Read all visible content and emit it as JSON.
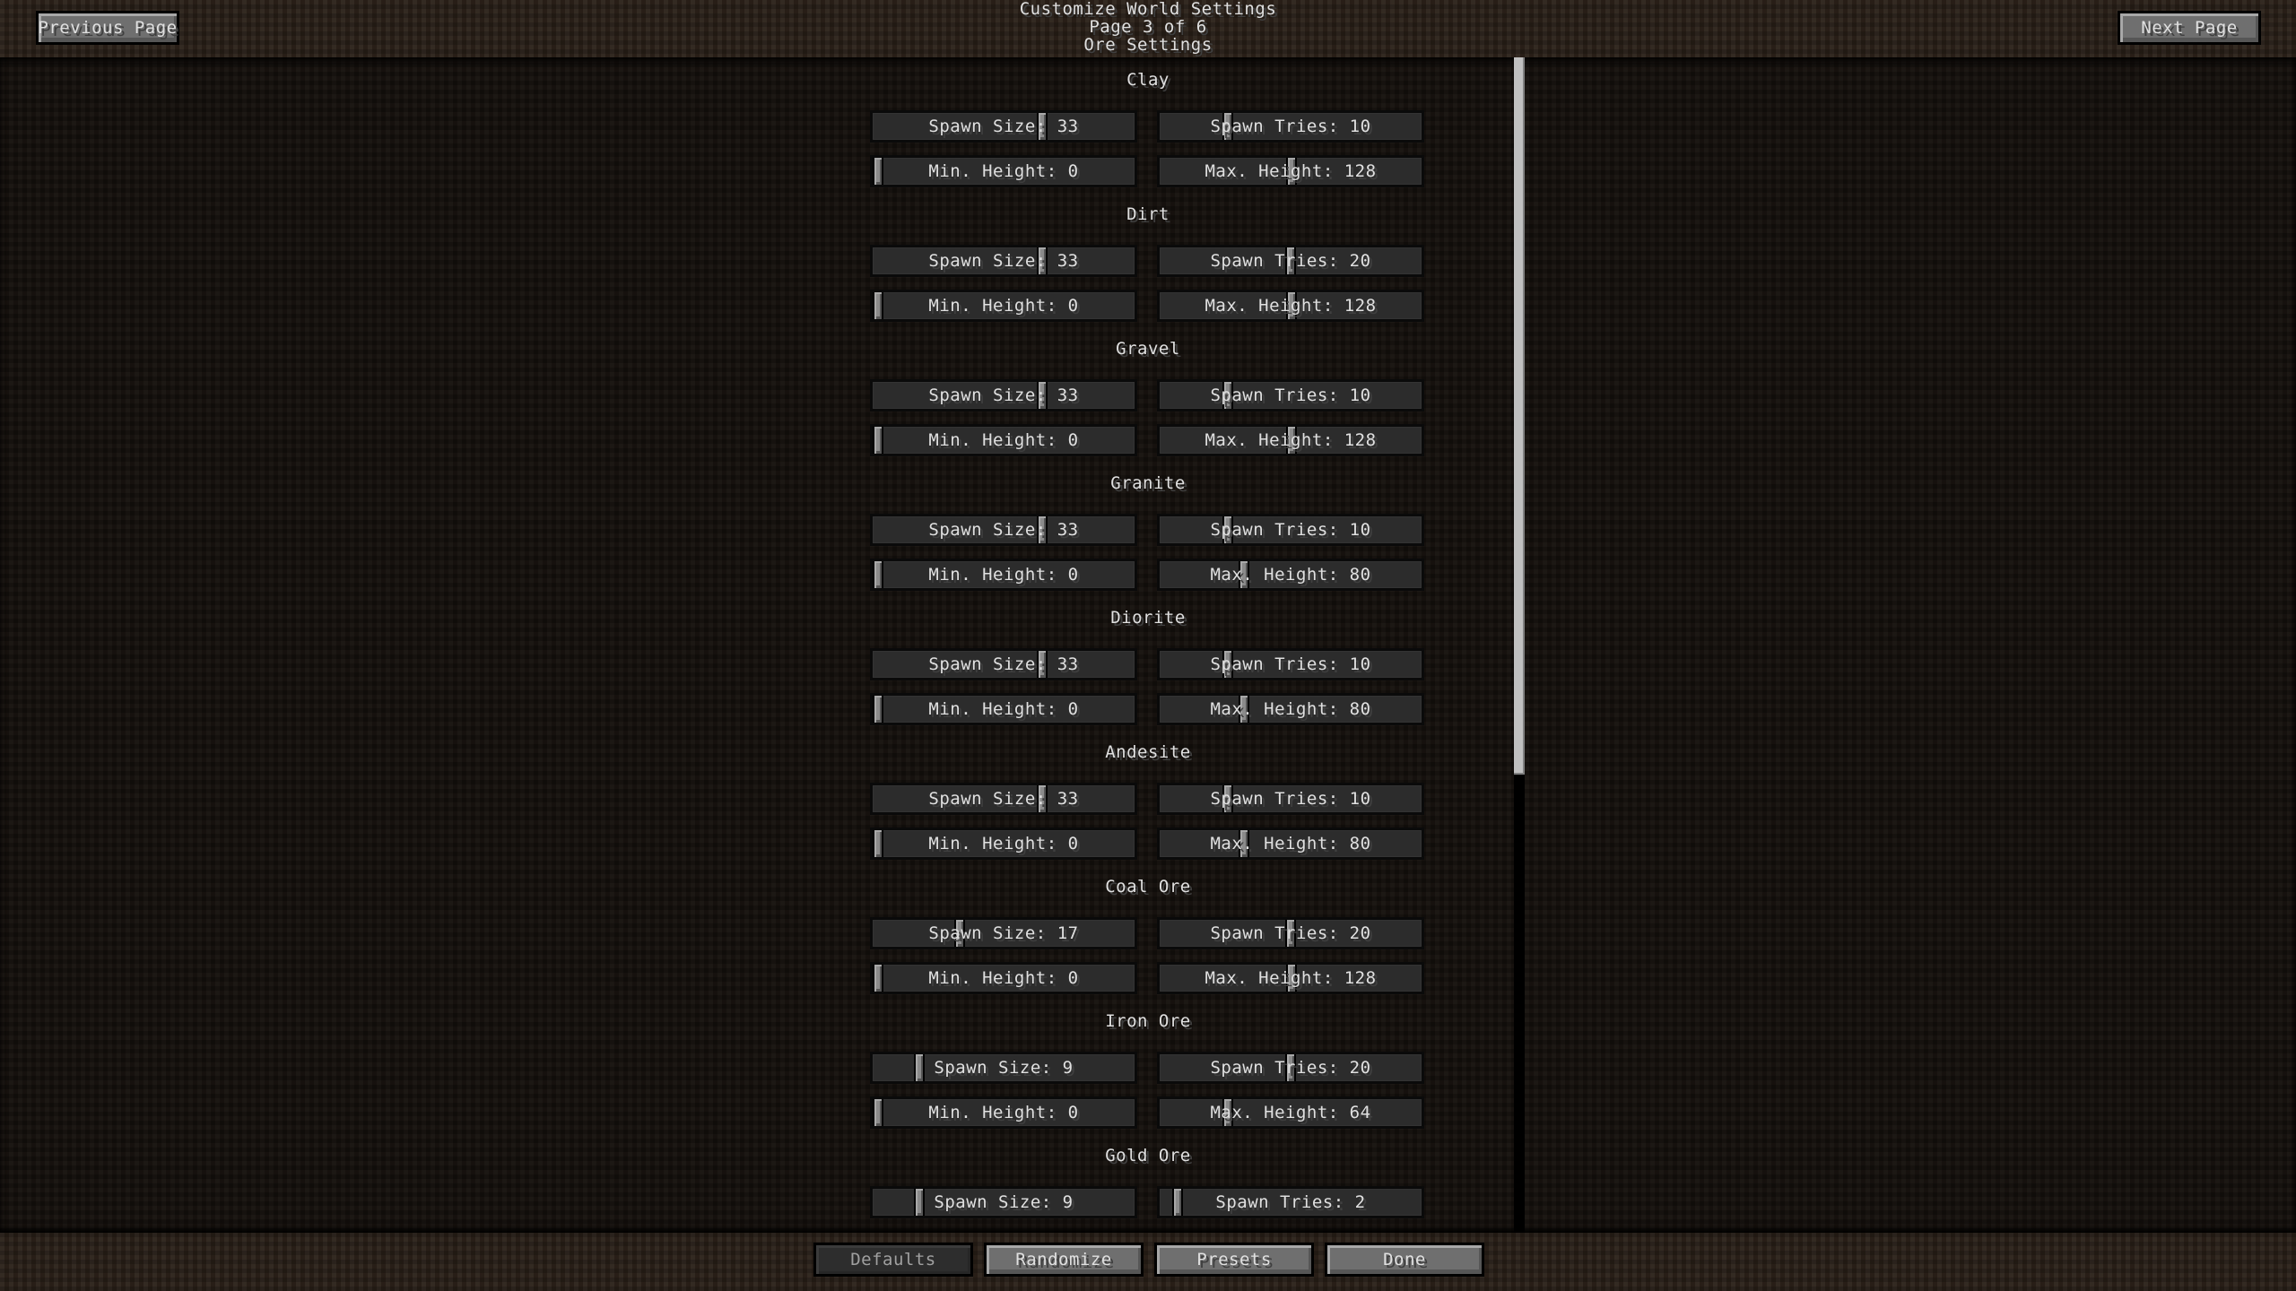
{
  "header": {
    "title": "Customize World Settings",
    "page_indicator": "Page 3 of 6",
    "page_name": "Ore Settings",
    "previous_label": "Previous Page",
    "next_label": "Next Page"
  },
  "sections": [
    {
      "name": "Clay",
      "sliders": [
        {
          "label": "Spawn Size",
          "value": 33,
          "min": 1,
          "max": 50
        },
        {
          "label": "Spawn Tries",
          "value": 10,
          "min": 0,
          "max": 40
        },
        {
          "label": "Min. Height",
          "value": 0,
          "min": 0,
          "max": 255
        },
        {
          "label": "Max. Height",
          "value": 128,
          "min": 0,
          "max": 255
        }
      ]
    },
    {
      "name": "Dirt",
      "sliders": [
        {
          "label": "Spawn Size",
          "value": 33,
          "min": 1,
          "max": 50
        },
        {
          "label": "Spawn Tries",
          "value": 20,
          "min": 0,
          "max": 40
        },
        {
          "label": "Min. Height",
          "value": 0,
          "min": 0,
          "max": 255
        },
        {
          "label": "Max. Height",
          "value": 128,
          "min": 0,
          "max": 255
        }
      ]
    },
    {
      "name": "Gravel",
      "sliders": [
        {
          "label": "Spawn Size",
          "value": 33,
          "min": 1,
          "max": 50
        },
        {
          "label": "Spawn Tries",
          "value": 10,
          "min": 0,
          "max": 40
        },
        {
          "label": "Min. Height",
          "value": 0,
          "min": 0,
          "max": 255
        },
        {
          "label": "Max. Height",
          "value": 128,
          "min": 0,
          "max": 255
        }
      ]
    },
    {
      "name": "Granite",
      "sliders": [
        {
          "label": "Spawn Size",
          "value": 33,
          "min": 1,
          "max": 50
        },
        {
          "label": "Spawn Tries",
          "value": 10,
          "min": 0,
          "max": 40
        },
        {
          "label": "Min. Height",
          "value": 0,
          "min": 0,
          "max": 255
        },
        {
          "label": "Max. Height",
          "value": 80,
          "min": 0,
          "max": 255
        }
      ]
    },
    {
      "name": "Diorite",
      "sliders": [
        {
          "label": "Spawn Size",
          "value": 33,
          "min": 1,
          "max": 50
        },
        {
          "label": "Spawn Tries",
          "value": 10,
          "min": 0,
          "max": 40
        },
        {
          "label": "Min. Height",
          "value": 0,
          "min": 0,
          "max": 255
        },
        {
          "label": "Max. Height",
          "value": 80,
          "min": 0,
          "max": 255
        }
      ]
    },
    {
      "name": "Andesite",
      "sliders": [
        {
          "label": "Spawn Size",
          "value": 33,
          "min": 1,
          "max": 50
        },
        {
          "label": "Spawn Tries",
          "value": 10,
          "min": 0,
          "max": 40
        },
        {
          "label": "Min. Height",
          "value": 0,
          "min": 0,
          "max": 255
        },
        {
          "label": "Max. Height",
          "value": 80,
          "min": 0,
          "max": 255
        }
      ]
    },
    {
      "name": "Coal Ore",
      "sliders": [
        {
          "label": "Spawn Size",
          "value": 17,
          "min": 1,
          "max": 50
        },
        {
          "label": "Spawn Tries",
          "value": 20,
          "min": 0,
          "max": 40
        },
        {
          "label": "Min. Height",
          "value": 0,
          "min": 0,
          "max": 255
        },
        {
          "label": "Max. Height",
          "value": 128,
          "min": 0,
          "max": 255
        }
      ]
    },
    {
      "name": "Iron Ore",
      "sliders": [
        {
          "label": "Spawn Size",
          "value": 9,
          "min": 1,
          "max": 50
        },
        {
          "label": "Spawn Tries",
          "value": 20,
          "min": 0,
          "max": 40
        },
        {
          "label": "Min. Height",
          "value": 0,
          "min": 0,
          "max": 255
        },
        {
          "label": "Max. Height",
          "value": 64,
          "min": 0,
          "max": 255
        }
      ]
    },
    {
      "name": "Gold Ore",
      "sliders": [
        {
          "label": "Spawn Size",
          "value": 9,
          "min": 1,
          "max": 50
        },
        {
          "label": "Spawn Tries",
          "value": 2,
          "min": 0,
          "max": 40
        }
      ]
    }
  ],
  "scrollbar": {
    "visible_fraction": 0.61,
    "position": 0
  },
  "footer": {
    "buttons": [
      {
        "id": "defaults",
        "label": "Defaults",
        "enabled": false
      },
      {
        "id": "randomize",
        "label": "Randomize",
        "enabled": true
      },
      {
        "id": "presets",
        "label": "Presets",
        "enabled": true
      },
      {
        "id": "done",
        "label": "Done",
        "enabled": true
      }
    ]
  }
}
